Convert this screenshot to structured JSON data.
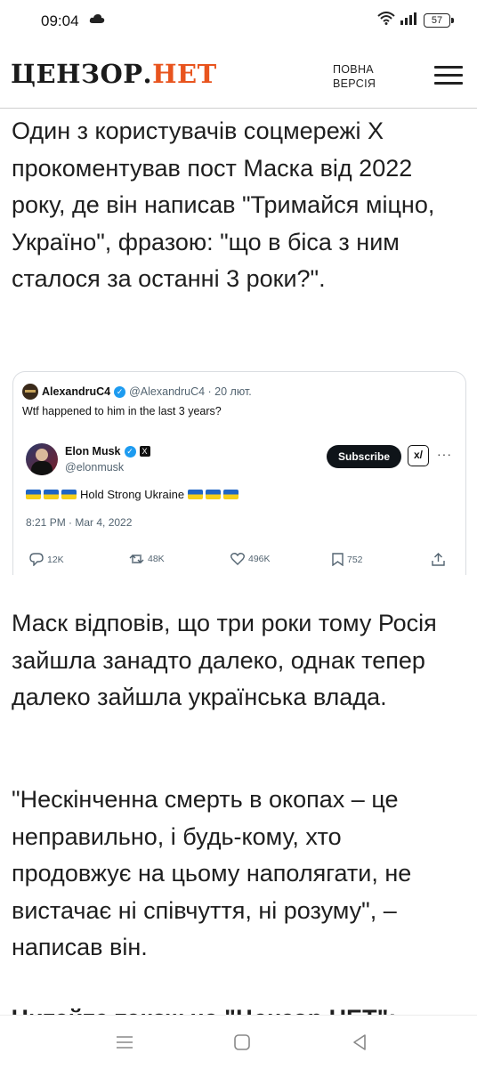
{
  "status_bar": {
    "time": "09:04",
    "battery": "57",
    "icons": [
      "cloud-icon",
      "wifi-icon",
      "signal-icon",
      "battery-icon"
    ]
  },
  "header": {
    "logo_main": "ЦЕНЗОР",
    "logo_dot": ".",
    "logo_accent": "НЕТ",
    "full_version_line1": "ПОВНА",
    "full_version_line2": "ВЕРСІЯ",
    "accent_color": "#e8541e"
  },
  "article": {
    "p1": "Один з користувачів соцмережі Х прокоментував пост Маска від 2022 року, де він написав \"Тримайся міцно, Україно\", фразою: \"що в біса з ним сталося за останні 3 роки?\".",
    "p2": "Маск відповів, що три роки тому Росія зайшла занадто далеко, однак тепер далеко зайшла українська влада.",
    "p3": "\"Нескінченна смерть в окопах – це неправильно, і будь-кому, хто продовжує на цьому наполягати, не вистачає ні співчуття, ні розуму\", – написав він.",
    "p4": "Читайте також на \"Цензор.НЕТ\":"
  },
  "tweet": {
    "quote_name": "AlexandruC4",
    "quote_handle_time": "@AlexandruC4 · 20 лют.",
    "quote_text": "Wtf happened to him in the last 3 years?",
    "author_name": "Elon Musk",
    "author_handle": "@elonmusk",
    "subscribe_label": "Subscribe",
    "grok_label": "x/",
    "more_label": "···",
    "body_text": "Hold Strong Ukraine",
    "timestamp": "8:21 PM · Mar 4, 2022",
    "replies": "12K",
    "reposts": "48K",
    "likes": "496K",
    "bookmarks": "752"
  },
  "navbar": {
    "buttons": [
      "menu-nav-icon",
      "home-nav-icon",
      "back-nav-icon"
    ]
  }
}
